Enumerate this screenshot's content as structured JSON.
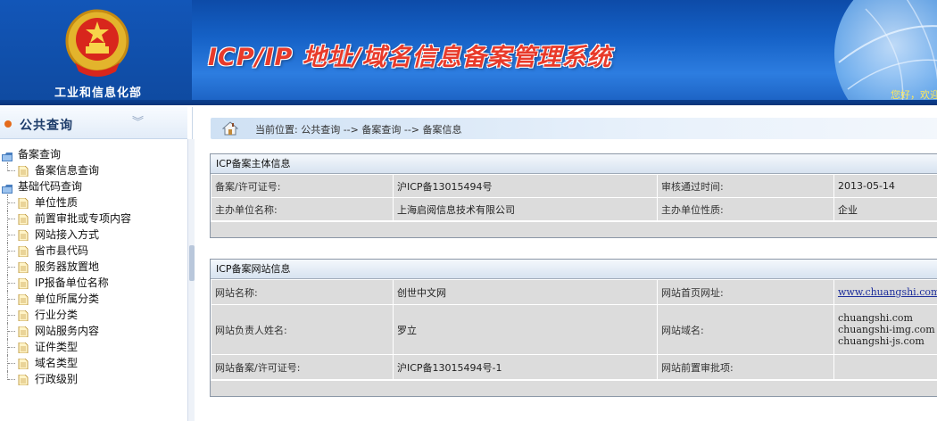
{
  "header": {
    "ministry_name": "工业和信息化部",
    "system_title": "ICP/IP 地址/域名信息备案管理系统",
    "greeting": "您好，欢迎"
  },
  "sidebar": {
    "title": "公共查询",
    "collapse_glyph": "︾",
    "groups": [
      {
        "label": "备案查询",
        "items": [
          "备案信息查询"
        ]
      },
      {
        "label": "基础代码查询",
        "items": [
          "单位性质",
          "前置审批或专项内容",
          "网站接入方式",
          "省市县代码",
          "服务器放置地",
          "IP报备单位名称",
          "单位所属分类",
          "行业分类",
          "网站服务内容",
          "证件类型",
          "域名类型",
          "行政级别"
        ]
      }
    ]
  },
  "breadcrumb": {
    "text": "当前位置: 公共查询 --> 备案查询 --> 备案信息"
  },
  "main_info": {
    "title": "ICP备案主体信息",
    "license_label": "备案/许可证号:",
    "license_value": "沪ICP备13015494号",
    "approved_time_label": "审核通过时间:",
    "approved_time_value": "2013-05-14",
    "org_name_label": "主办单位名称:",
    "org_name_value": "上海启阅信息技术有限公司",
    "org_type_label": "主办单位性质:",
    "org_type_value": "企业"
  },
  "site_info": {
    "title": "ICP备案网站信息",
    "site_name_label": "网站名称:",
    "site_name_value": "创世中文网",
    "homepage_label": "网站首页网址:",
    "homepage_value": "www.chuangshi.com",
    "owner_label": "网站负责人姓名:",
    "owner_value": "罗立",
    "domain_label": "网站域名:",
    "domains": [
      "chuangshi.com",
      "chuangshi-img.com",
      "chuangshi-js.com"
    ],
    "site_license_label": "网站备案/许可证号:",
    "site_license_value": "沪ICP备13015494号-1",
    "pre_approval_label": "网站前置审批项:",
    "pre_approval_value": ""
  },
  "colors": {
    "header_blue": "#1561c6",
    "title_red": "#e83a2a",
    "panel_gray": "#dcdcdc",
    "link_blue": "#1e2f9c"
  },
  "icons": {
    "emblem": "national-emblem-icon",
    "home": "home-icon",
    "group": "folder-group-icon",
    "item": "document-icon"
  }
}
